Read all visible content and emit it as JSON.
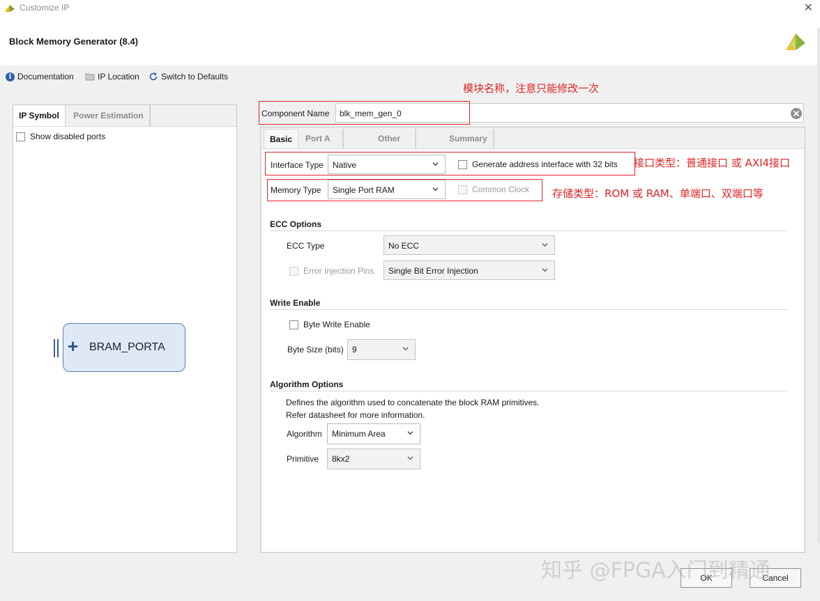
{
  "window": {
    "title": "Customize IP"
  },
  "header": {
    "title": "Block Memory Generator (8.4)"
  },
  "toolbar": {
    "documentation": "Documentation",
    "ip_location": "IP Location",
    "switch_defaults": "Switch to Defaults"
  },
  "left": {
    "tabs": [
      "IP Symbol",
      "Power Estimation"
    ],
    "show_disabled_ports": "Show disabled ports",
    "bram_port": "BRAM_PORTA"
  },
  "component": {
    "label": "Component Name",
    "value": "blk_mem_gen_0"
  },
  "tabs": [
    "Basic",
    "Port A Options",
    "Other Options",
    "Summary"
  ],
  "basic": {
    "interface_type_label": "Interface Type",
    "interface_type_value": "Native",
    "addr32_label": "Generate address interface with 32 bits",
    "memory_type_label": "Memory Type",
    "memory_type_value": "Single Port RAM",
    "common_clock_label": "Common Clock",
    "ecc": {
      "title": "ECC Options",
      "type_label": "ECC Type",
      "type_value": "No ECC",
      "injection_label": "Error Injection Pins",
      "injection_value": "Single Bit Error Injection"
    },
    "write_enable": {
      "title": "Write Enable",
      "byte_we_label": "Byte Write Enable",
      "byte_size_label": "Byte Size (bits)",
      "byte_size_value": "9"
    },
    "algorithm": {
      "title": "Algorithm Options",
      "desc1": "Defines the algorithm used to concatenate the block RAM primitives.",
      "desc2": "Refer datasheet for more information.",
      "algorithm_label": "Algorithm",
      "algorithm_value": "Minimum Area",
      "primitive_label": "Primitive",
      "primitive_value": "8kx2"
    }
  },
  "annotations": {
    "component": "模块名称，注意只能修改一次",
    "interface": "接口类型：普通接口 或 AXI4接口",
    "memory": "存储类型：ROM 或 RAM、单端口、双端口等"
  },
  "buttons": {
    "ok": "OK",
    "cancel": "Cancel"
  },
  "watermark": "知乎 @FPGA入门到精通",
  "colors": {
    "annotation": "#e02424",
    "bram_fill": "#dfe9f6",
    "bram_border": "#5b7fb5",
    "info_icon": "#2d5fa8"
  }
}
